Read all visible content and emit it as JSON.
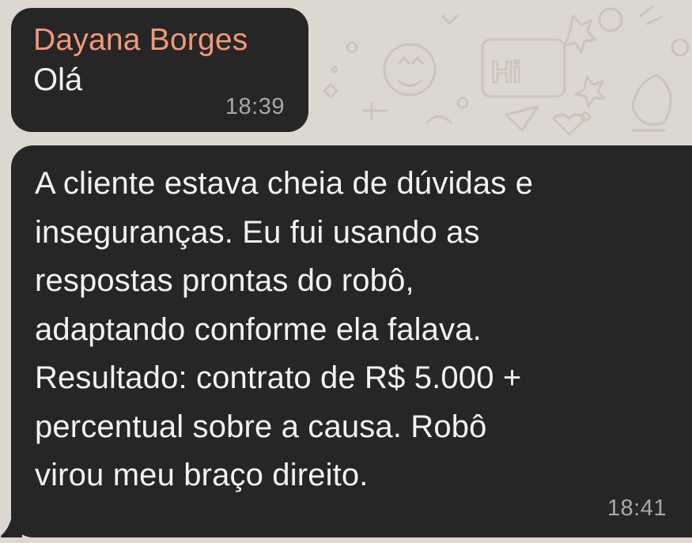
{
  "messages": [
    {
      "sender": "Dayana Borges",
      "text": "Olá",
      "time": "18:39"
    },
    {
      "text": "A cliente estava cheia de dúvidas e\ninseguranças. Eu fui usando as\nrespostas prontas do robô,\nadaptando conforme ela falava.\nResultado: contrato de R$ 5.000 +\npercentual sobre a causa. Robô\nvirou meu braço direito.",
      "time": "18:41"
    }
  ],
  "wallpaper": {
    "doodle_text": "Hi"
  },
  "colors": {
    "background": "#dcd7cf",
    "bubble": "#262626",
    "sender_name": "#f39878",
    "message_text": "#f2f2f2",
    "timestamp": "#a7a7a7"
  }
}
